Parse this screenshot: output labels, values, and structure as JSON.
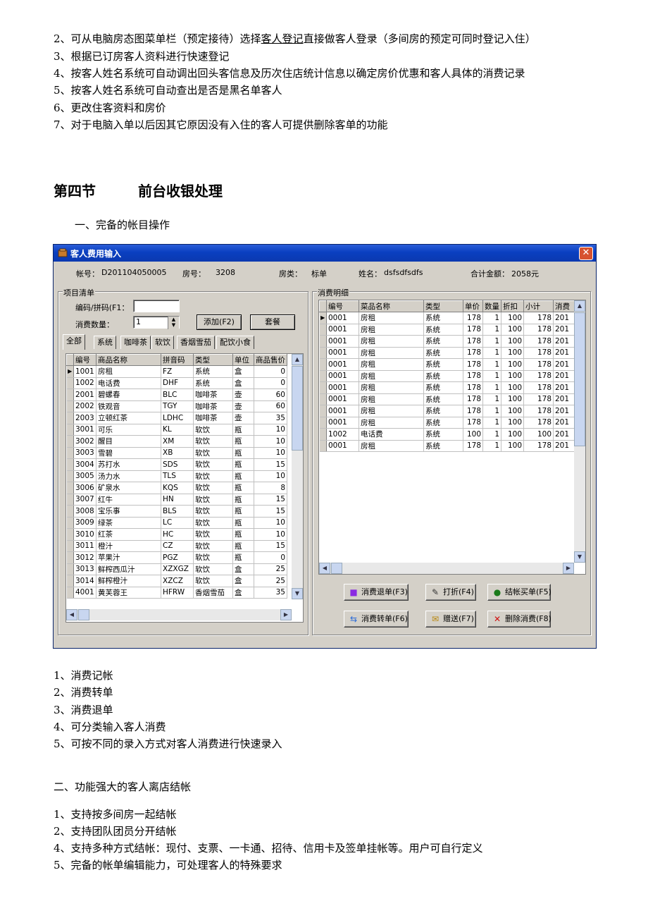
{
  "intro_lines": [
    {
      "pre": "2、可从电脑房态图菜单栏（预定接待）选择",
      "link": "客人登记",
      "post": "直接做客人登录（多间房的预定可同时登记入住）"
    },
    {
      "text": "3、根据已订房客人资料进行快速登记"
    },
    {
      "text": "4、按客人姓名系统可自动调出回头客信息及历次住店统计信息以确定房价优惠和客人具体的消费记录"
    },
    {
      "text": "5、按客人姓名系统可自动查出是否是黑名单客人"
    },
    {
      "text": "6、更改住客资料和房价"
    },
    {
      "text": "7、对于电脑入单以后因其它原因没有入住的客人可提供删除客单的功能"
    }
  ],
  "section": {
    "num": "第四节",
    "title": "前台收银处理"
  },
  "subsection1": "一、完备的帐目操作",
  "window": {
    "title": "客人费用输入",
    "close_glyph": "✕",
    "info": {
      "account_label": "帐号：",
      "account": "D201104050005",
      "room_label": "房号：",
      "room": "3208",
      "roomtype_label": "房类：",
      "roomtype": "标单",
      "name_label": "姓名：",
      "name": "dsfsdfsdfs",
      "total_label": "合计金额：",
      "total": "2058元"
    },
    "items_group": {
      "label": "项目清单",
      "code_label": "编码/拼码(F1：",
      "code_value": "",
      "qty_label": "消费数量：",
      "qty_value": "1",
      "add_button": "添加(F2)",
      "package_button": "套餐",
      "tabs": [
        "全部",
        "系统",
        "咖啡茶",
        "软饮",
        "香烟雪茄",
        "配饮小食"
      ],
      "columns": [
        "编号",
        "商品名称",
        "拼音码",
        "类型",
        "单位",
        "商品售价"
      ],
      "rows": [
        [
          "1001",
          "房租",
          "FZ",
          "系统",
          "盒",
          "0"
        ],
        [
          "1002",
          "电话费",
          "DHF",
          "系统",
          "盒",
          "0"
        ],
        [
          "2001",
          "碧螺春",
          "BLC",
          "咖啡茶",
          "壶",
          "60"
        ],
        [
          "2002",
          "铁观音",
          "TGY",
          "咖啡茶",
          "壶",
          "60"
        ],
        [
          "2003",
          "立顿红茶",
          "LDHC",
          "咖啡茶",
          "壶",
          "35"
        ],
        [
          "3001",
          "可乐",
          "KL",
          "软饮",
          "瓶",
          "10"
        ],
        [
          "3002",
          "醒目",
          "XM",
          "软饮",
          "瓶",
          "10"
        ],
        [
          "3003",
          "雪碧",
          "XB",
          "软饮",
          "瓶",
          "10"
        ],
        [
          "3004",
          "苏打水",
          "SDS",
          "软饮",
          "瓶",
          "15"
        ],
        [
          "3005",
          "汤力水",
          "TLS",
          "软饮",
          "瓶",
          "10"
        ],
        [
          "3006",
          "矿泉水",
          "KQS",
          "软饮",
          "瓶",
          "8"
        ],
        [
          "3007",
          "红牛",
          "HN",
          "软饮",
          "瓶",
          "15"
        ],
        [
          "3008",
          "宝乐事",
          "BLS",
          "软饮",
          "瓶",
          "15"
        ],
        [
          "3009",
          "绿茶",
          "LC",
          "软饮",
          "瓶",
          "10"
        ],
        [
          "3010",
          "红茶",
          "HC",
          "软饮",
          "瓶",
          "10"
        ],
        [
          "3011",
          "橙汁",
          "CZ",
          "软饮",
          "瓶",
          "15"
        ],
        [
          "3012",
          "苹果汁",
          "PGZ",
          "软饮",
          "瓶",
          "0"
        ],
        [
          "3013",
          "鲜榨西瓜汁",
          "XZXGZ",
          "软饮",
          "盒",
          "25"
        ],
        [
          "3014",
          "鲜榨橙汁",
          "XZCZ",
          "软饮",
          "盒",
          "25"
        ],
        [
          "4001",
          "黄芙蓉王",
          "HFRW",
          "香烟雪茄",
          "盒",
          "35"
        ]
      ]
    },
    "detail_group": {
      "label": "消费明细",
      "columns": [
        "编号",
        "菜品名称",
        "类型",
        "单价",
        "数量",
        "折扣",
        "小计",
        "消费"
      ],
      "rows": [
        [
          "0001",
          "房租",
          "系统",
          "178",
          "1",
          "100",
          "178",
          "201"
        ],
        [
          "0001",
          "房租",
          "系统",
          "178",
          "1",
          "100",
          "178",
          "201"
        ],
        [
          "0001",
          "房租",
          "系统",
          "178",
          "1",
          "100",
          "178",
          "201"
        ],
        [
          "0001",
          "房租",
          "系统",
          "178",
          "1",
          "100",
          "178",
          "201"
        ],
        [
          "0001",
          "房租",
          "系统",
          "178",
          "1",
          "100",
          "178",
          "201"
        ],
        [
          "0001",
          "房租",
          "系统",
          "178",
          "1",
          "100",
          "178",
          "201"
        ],
        [
          "0001",
          "房租",
          "系统",
          "178",
          "1",
          "100",
          "178",
          "201"
        ],
        [
          "0001",
          "房租",
          "系统",
          "178",
          "1",
          "100",
          "178",
          "201"
        ],
        [
          "0001",
          "房租",
          "系统",
          "178",
          "1",
          "100",
          "178",
          "201"
        ],
        [
          "0001",
          "房租",
          "系统",
          "178",
          "1",
          "100",
          "178",
          "201"
        ],
        [
          "1002",
          "电话费",
          "系统",
          "100",
          "1",
          "100",
          "100",
          "201"
        ],
        [
          "0001",
          "房租",
          "系统",
          "178",
          "1",
          "100",
          "178",
          "201"
        ]
      ],
      "buttons": {
        "refund": "消费退单(F3)",
        "discount": "打折(F4)",
        "checkout": "结帐买单(F5)",
        "transfer": "消费转单(F6)",
        "gift": "赠送(F7)",
        "delete": "删除消费(F8)"
      }
    }
  },
  "list1": [
    "1、消费记帐",
    "2、消费转单",
    "3、消费退单",
    "4、可分类输入客人消费",
    "5、可按不同的录入方式对客人消费进行快速录入"
  ],
  "subsection2": "二、功能强大的客人离店结帐",
  "list2": [
    "1、支持按多间房一起结帐",
    "2、支持团队团员分开结帐",
    "4、支持多种方式结帐：现付、支票、一卡通、招待、信用卡及签单挂帐等。用户可自行定义",
    "5、完备的帐单编辑能力，可处理客人的特殊要求"
  ]
}
